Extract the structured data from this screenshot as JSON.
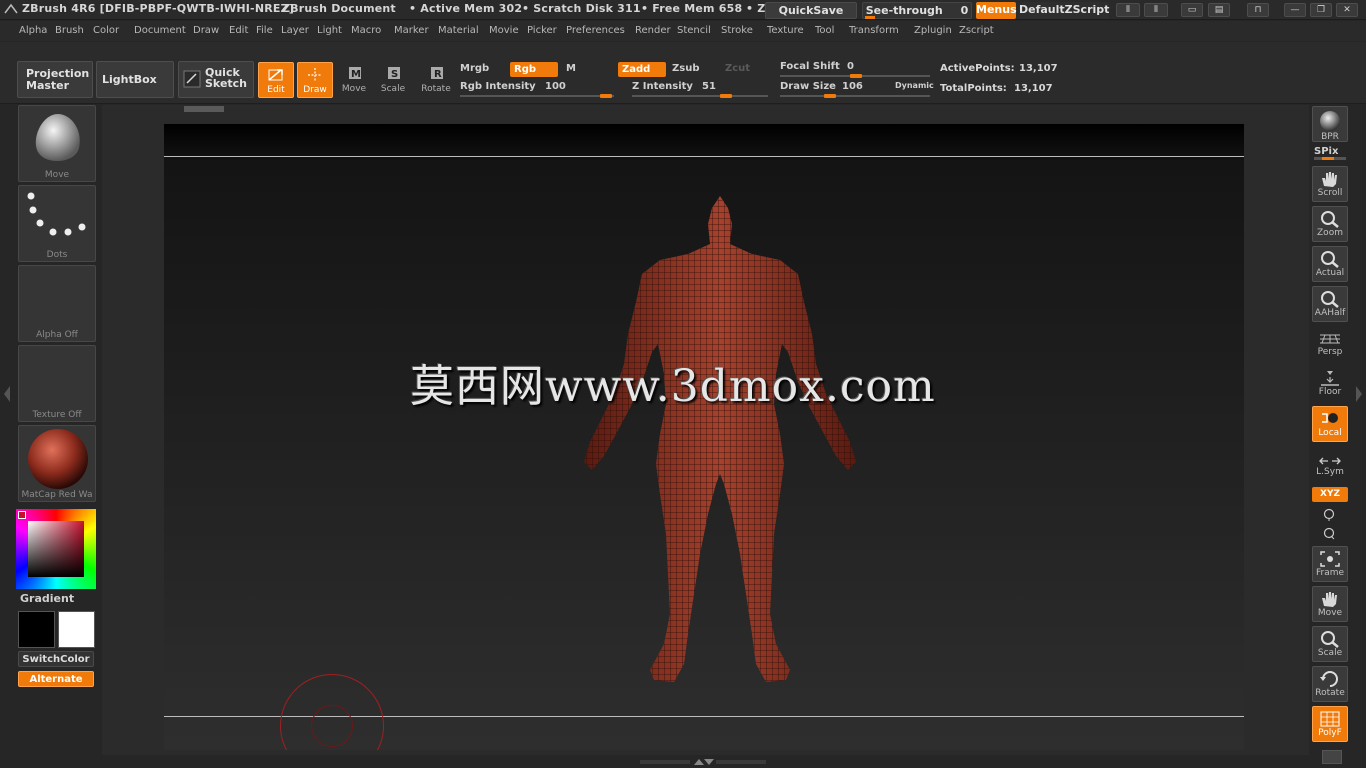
{
  "titlebar": {
    "app": "ZBrush 4R6 [DFIB-PBPF-QWTB-IWHI-NREZ]",
    "document": "ZBrush Document",
    "active_mem": "• Active Mem 302",
    "scratch_disk": "• Scratch Disk 311",
    "free_mem": "• Free Mem 658",
    "z": "• Z",
    "quicksave": "QuickSave",
    "see_through": "See-through",
    "see_through_value": "0",
    "menus": "Menus",
    "default_zscript": "DefaultZScript"
  },
  "menubar": {
    "items": [
      "Alpha",
      "Brush",
      "Color",
      "Document",
      "Draw",
      "Edit",
      "File",
      "Layer",
      "Light",
      "Macro",
      "Marker",
      "Material",
      "Movie",
      "Picker",
      "Preferences",
      "Render",
      "Stencil",
      "Stroke",
      "Texture",
      "Tool",
      "Transform",
      "Zplugin",
      "Zscript"
    ]
  },
  "toolbar": {
    "projection_master_1": "Projection",
    "projection_master_2": "Master",
    "lightbox": "LightBox",
    "quick_sketch_1": "Quick",
    "quick_sketch_2": "Sketch",
    "edit": "Edit",
    "draw": "Draw",
    "move": "Move",
    "scale": "Scale",
    "rotate": "Rotate",
    "mrgb": "Mrgb",
    "rgb": "Rgb",
    "m": "M",
    "zadd": "Zadd",
    "zsub": "Zsub",
    "zcut": "Zcut",
    "rgb_intensity_label": "Rgb Intensity",
    "rgb_intensity_value": "100",
    "z_intensity_label": "Z Intensity",
    "z_intensity_value": "51",
    "focal_shift_label": "Focal Shift",
    "focal_shift_value": "0",
    "draw_size_label": "Draw Size",
    "draw_size_value": "106",
    "dynamic": "Dynamic",
    "active_points_label": "ActivePoints:",
    "active_points_value": "13,107",
    "total_points_label": "TotalPoints:",
    "total_points_value": "13,107"
  },
  "left_shelf": {
    "brush_label": "Move",
    "stroke_label": "Dots",
    "alpha_label": "Alpha Off",
    "texture_label": "Texture Off",
    "material_label": "MatCap Red Wa",
    "gradient": "Gradient",
    "switch_color": "SwitchColor",
    "alternate": "Alternate"
  },
  "canvas": {
    "watermark": "莫西网www.3dmox.com"
  },
  "right_shelf": {
    "bpr": "BPR",
    "spix": "SPix",
    "scroll": "Scroll",
    "zoom": "Zoom",
    "actual": "Actual",
    "aahalf": "AAHalf",
    "persp": "Persp",
    "floor": "Floor",
    "local": "Local",
    "lsym": "L.Sym",
    "xyz": "XYZ",
    "frame": "Frame",
    "move": "Move",
    "scale": "Scale",
    "rotate": "Rotate",
    "polyf": "PolyF"
  },
  "colors": {
    "accent": "#f07a0a",
    "panel": "#2b2b2b",
    "model": "#8b2a1c"
  }
}
